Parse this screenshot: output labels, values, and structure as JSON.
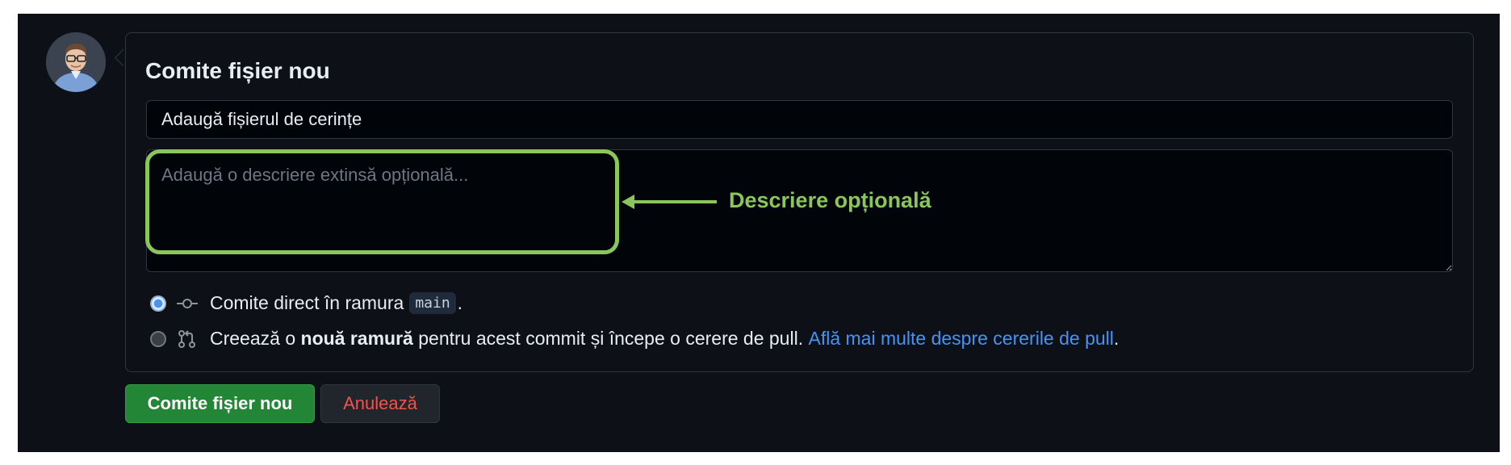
{
  "form": {
    "heading": "Comite fișier nou",
    "summary_value": "Adaugă fișierul de cerințe",
    "description_placeholder": "Adaugă o descriere extinsă opțională..."
  },
  "annotation": {
    "callout": "Descriere opțională",
    "color": "#8bc65a"
  },
  "options": {
    "direct": {
      "text_before": "Comite direct în ramura",
      "branch": "main",
      "text_after": ".",
      "selected": true,
      "icon": "git-commit-icon"
    },
    "new_branch": {
      "text_before": "Creează o",
      "bold": "nouă ramură",
      "text_middle": "pentru acest commit și începe o cerere de pull.",
      "link": "Află mai multe despre cererile de pull",
      "text_after": ".",
      "selected": false,
      "icon": "git-pull-request-icon"
    }
  },
  "buttons": {
    "commit": "Comite fișier nou",
    "cancel": "Anulează"
  },
  "colors": {
    "background": "#0d1117",
    "primary_button": "#238636",
    "danger_text": "#f85149",
    "link": "#4493f8"
  }
}
